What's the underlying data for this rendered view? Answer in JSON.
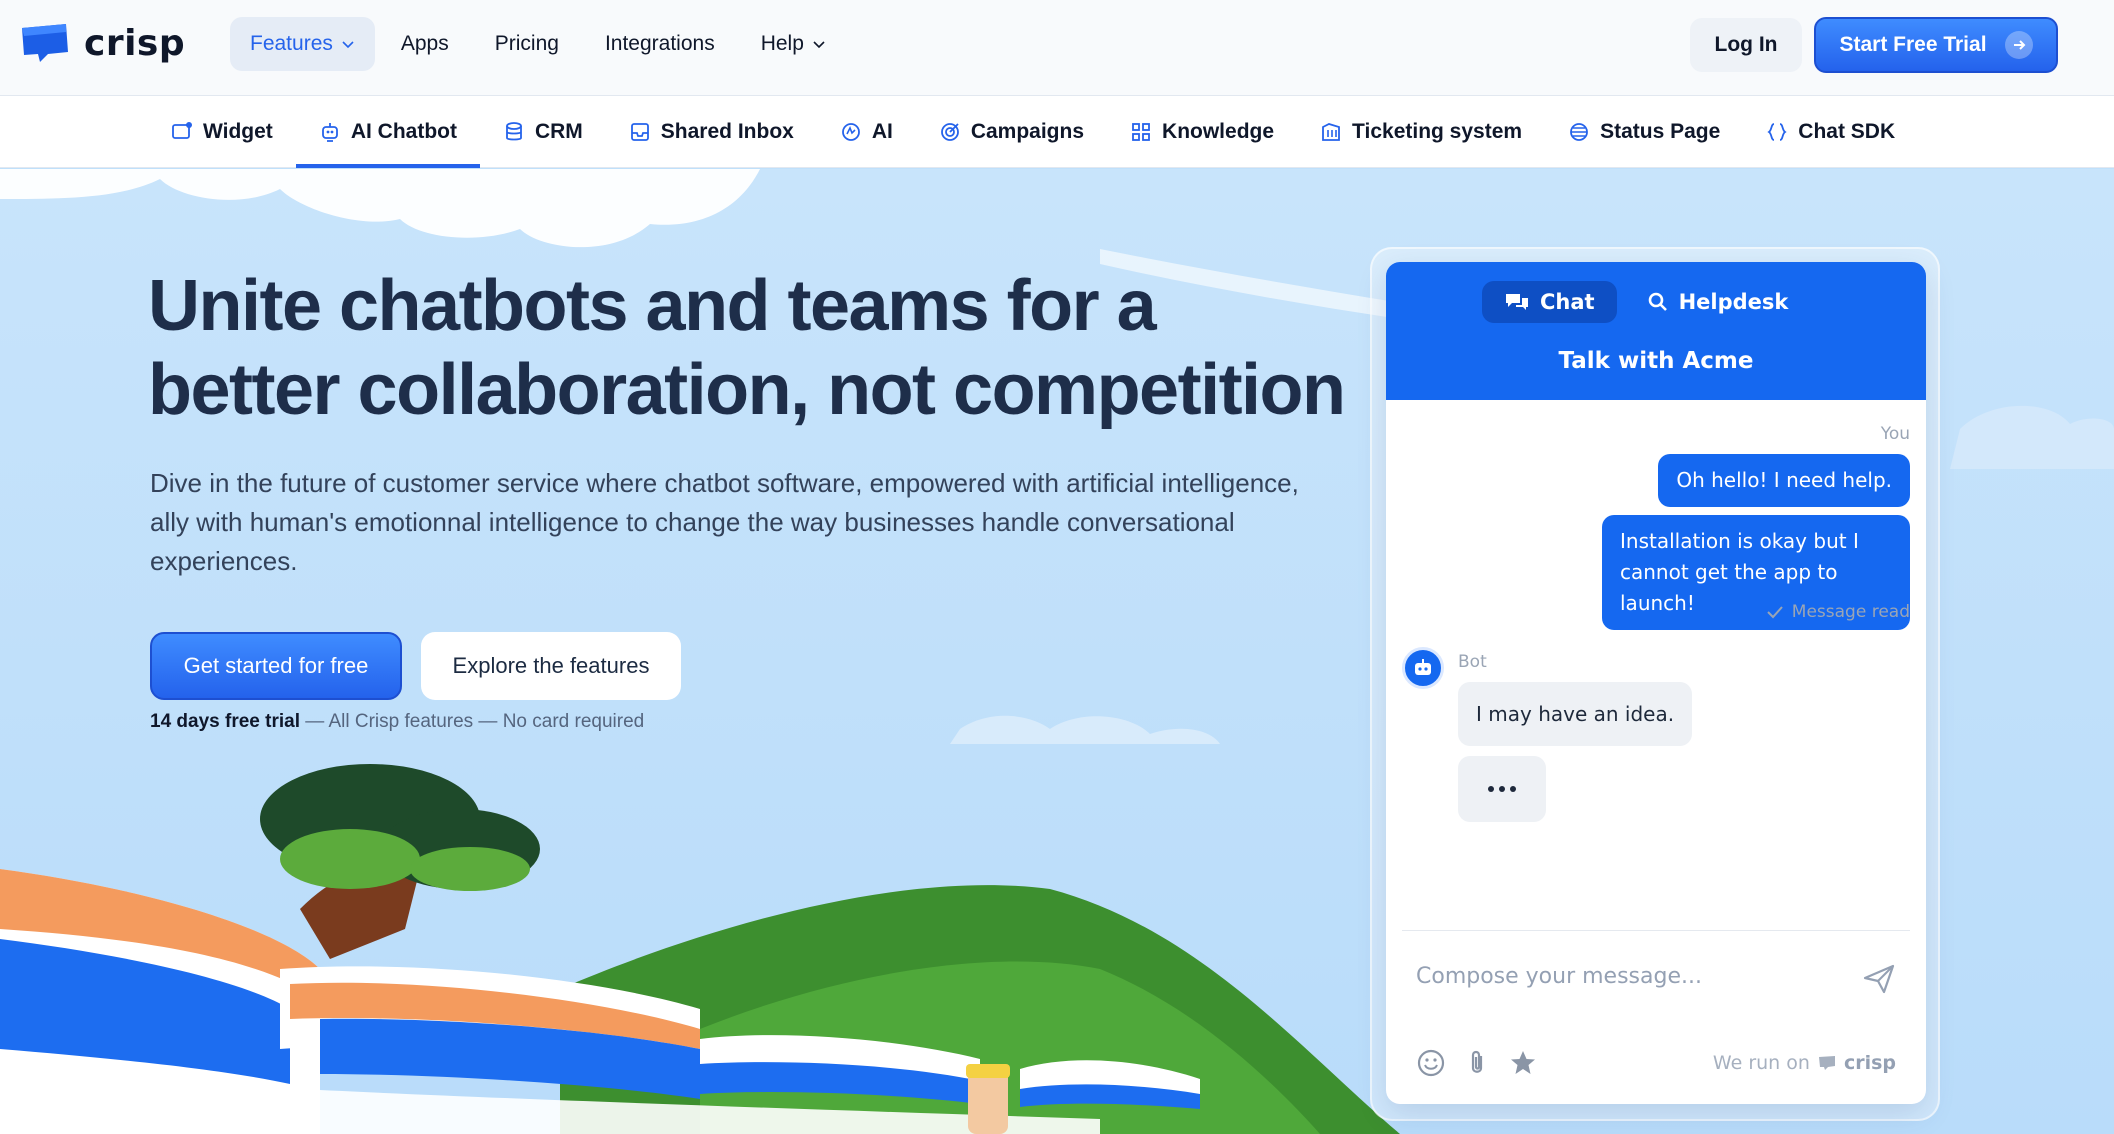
{
  "header": {
    "brand": "crisp",
    "nav": [
      {
        "label": "Features",
        "dropdown": true,
        "active": true
      },
      {
        "label": "Apps",
        "dropdown": false
      },
      {
        "label": "Pricing",
        "dropdown": false
      },
      {
        "label": "Integrations",
        "dropdown": false
      },
      {
        "label": "Help",
        "dropdown": true
      }
    ],
    "login_label": "Log In",
    "trial_label": "Start Free Trial"
  },
  "subnav": {
    "items": [
      {
        "label": "Widget",
        "icon": "widget-icon"
      },
      {
        "label": "AI Chatbot",
        "icon": "robot-icon",
        "active": true
      },
      {
        "label": "CRM",
        "icon": "database-icon"
      },
      {
        "label": "Shared Inbox",
        "icon": "inbox-icon"
      },
      {
        "label": "AI",
        "icon": "ai-icon"
      },
      {
        "label": "Campaigns",
        "icon": "target-icon"
      },
      {
        "label": "Knowledge",
        "icon": "grid-icon"
      },
      {
        "label": "Ticketing system",
        "icon": "ticket-icon"
      },
      {
        "label": "Status Page",
        "icon": "status-icon"
      },
      {
        "label": "Chat SDK",
        "icon": "braces-icon"
      }
    ]
  },
  "hero": {
    "headline_line1": "Unite chatbots and teams for a",
    "headline_line2": "better collaboration, not competition",
    "subtitle": "Dive in the future of customer service where chatbot software, empowered with artificial intelligence, ally with human's emotionnal intelligence to change the way businesses handle conversational experiences.",
    "cta_primary": "Get started for free",
    "cta_secondary": "Explore the features",
    "trial_note_bold": "14 days free trial",
    "trial_note_rest": " — All Crisp features — No card required"
  },
  "widget": {
    "tabs": [
      {
        "label": "Chat",
        "icon": "chat-bubbles-icon",
        "active": true
      },
      {
        "label": "Helpdesk",
        "icon": "search-icon",
        "active": false
      }
    ],
    "title": "Talk with Acme",
    "you_label": "You",
    "messages_me": [
      "Oh hello! I need help.",
      "Installation is okay but I cannot get the app to launch!"
    ],
    "read_status": "Message read",
    "bot_name": "Bot",
    "bot_message": "I may have an idea.",
    "compose_placeholder": "Compose your message...",
    "runs_on_prefix": "We run on",
    "runs_on_brand": "crisp"
  },
  "colors": {
    "primary": "#2563eb",
    "widget_header": "#1568f0",
    "sky": "#bfe0fb",
    "grass": "#3d8f2f"
  }
}
